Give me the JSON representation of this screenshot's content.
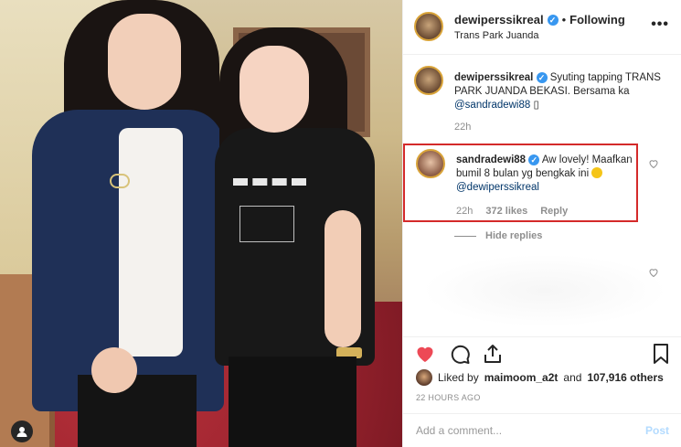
{
  "header": {
    "username": "dewiperssikreal",
    "separator": "•",
    "follow_status": "Following",
    "location": "Trans Park Juanda",
    "more_icon": "more-horizontal-icon"
  },
  "caption": {
    "username": "dewiperssikreal",
    "text_before_mention": "Syuting tapping TRANS PARK JUANDA BEKASI. Bersama ka",
    "mention": "@sandradewi88",
    "trailing": "▯",
    "time": "22h"
  },
  "reply": {
    "username": "sandradewi88",
    "text": "Aw lovely! Maafkan bumil 8 bulan yg bengkak ini",
    "mention": "@dewiperssikreal",
    "time": "22h",
    "likes": "372 likes",
    "reply_label": "Reply",
    "highlight_color": "#d42a2a"
  },
  "hide_replies": "Hide replies",
  "likes": {
    "prefix": "Liked by",
    "user": "maimoom_a2t",
    "and": "and",
    "others": "107,916 others"
  },
  "post_time": "22 HOURS AGO",
  "comment": {
    "placeholder": "Add a comment...",
    "post_label": "Post"
  },
  "colors": {
    "heart": "#ed4956",
    "verified": "#3897f0",
    "link": "#003569"
  }
}
